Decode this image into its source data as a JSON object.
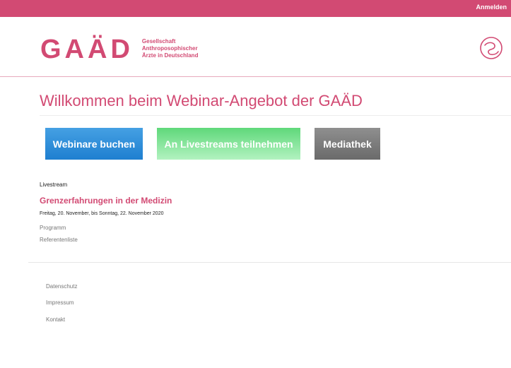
{
  "topbar": {
    "login_label": "Anmelden",
    "color": "#d24a73"
  },
  "header": {
    "logo_mark": "GAÄD",
    "logo_lines": [
      "Gesellschaft",
      "Anthroposophischer",
      "Ärzte in Deutschland"
    ],
    "symbol_icon": "spiral-logo-icon"
  },
  "main": {
    "title": "Willkommen beim Webinar-Angebot der GAÄD",
    "buttons": [
      {
        "label": "Webinare buchen",
        "color": "#1e7fd0"
      },
      {
        "label": "An Livestreams teilnehmen",
        "color": "#5fd87a"
      },
      {
        "label": "Mediathek",
        "color": "#7a7a7a"
      }
    ]
  },
  "event": {
    "category": "Livestream",
    "title": "Grenzerfahrungen in der Medizin",
    "date": "Freitag, 20. November, bis Sonntag, 22. November 2020",
    "links": [
      "Programm",
      "Referentenliste"
    ]
  },
  "footer": {
    "links": [
      "Datenschutz",
      "Impressum",
      "Kontakt"
    ]
  }
}
